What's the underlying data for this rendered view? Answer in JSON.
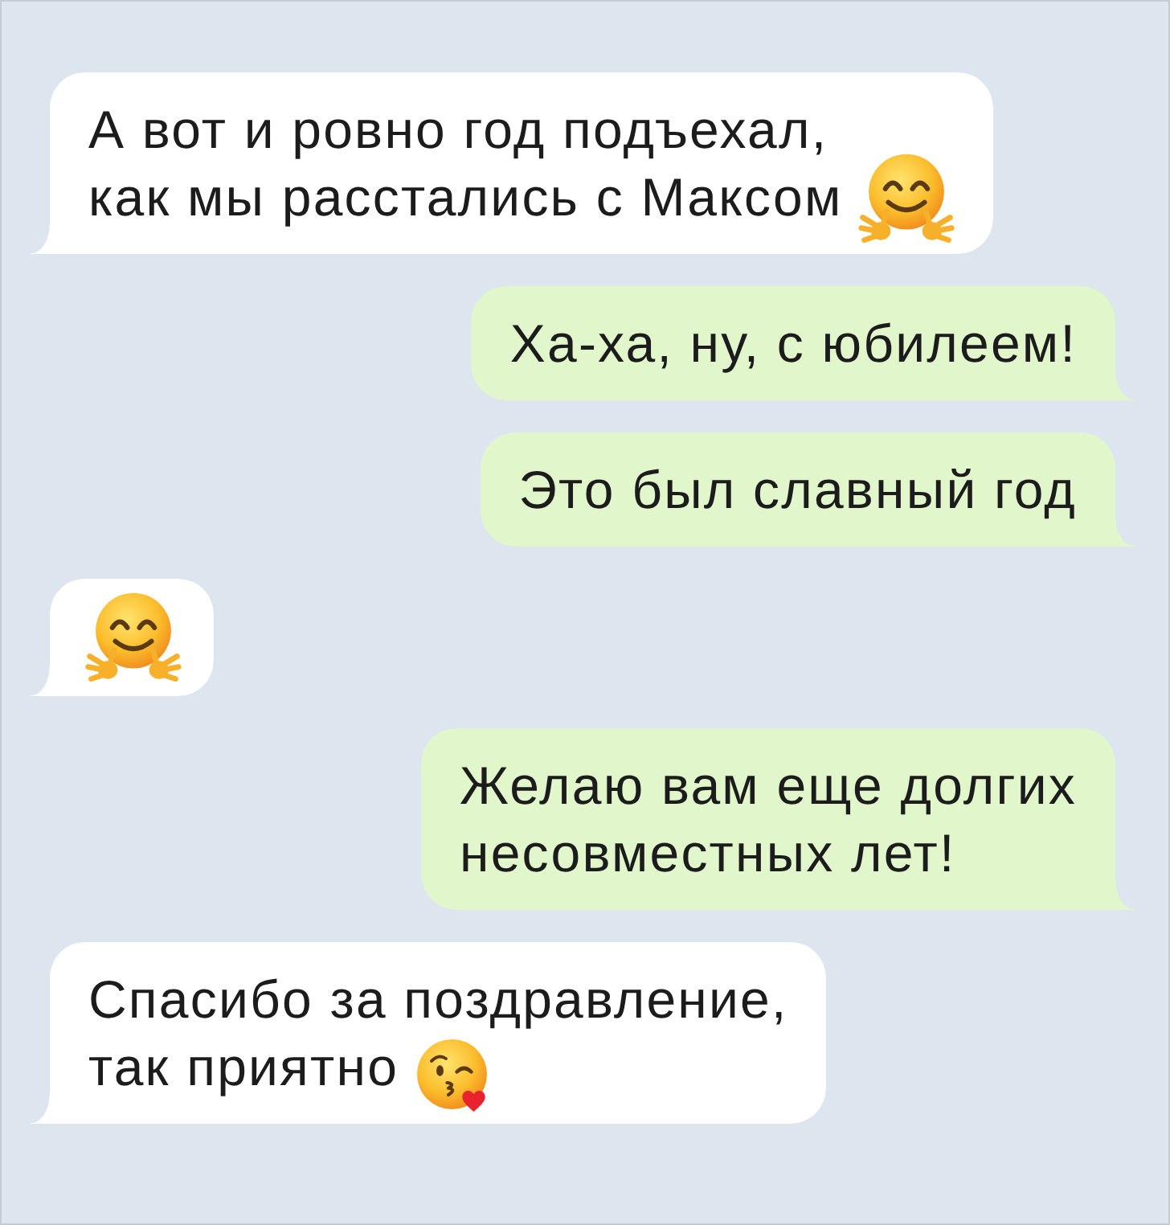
{
  "messages": [
    {
      "kind": "incoming",
      "lines": [
        "А вот и ровно год подъехал,",
        "как мы расстались с Максом"
      ],
      "emoji": {
        "kind": "hug"
      }
    },
    {
      "kind": "outgoing",
      "lines": [
        "Ха-ха, ну, с юбилеем!"
      ]
    },
    {
      "kind": "outgoing",
      "lines": [
        "Это был славный год"
      ]
    },
    {
      "kind": "incoming",
      "emoji": {
        "kind": "hug"
      }
    },
    {
      "kind": "outgoing",
      "lines": [
        "Желаю вам еще долгих",
        "несовместных лет!"
      ]
    },
    {
      "kind": "incoming",
      "lines": [
        "Спасибо за поздравление,",
        "так приятно"
      ],
      "emoji": {
        "kind": "kiss"
      }
    }
  ]
}
